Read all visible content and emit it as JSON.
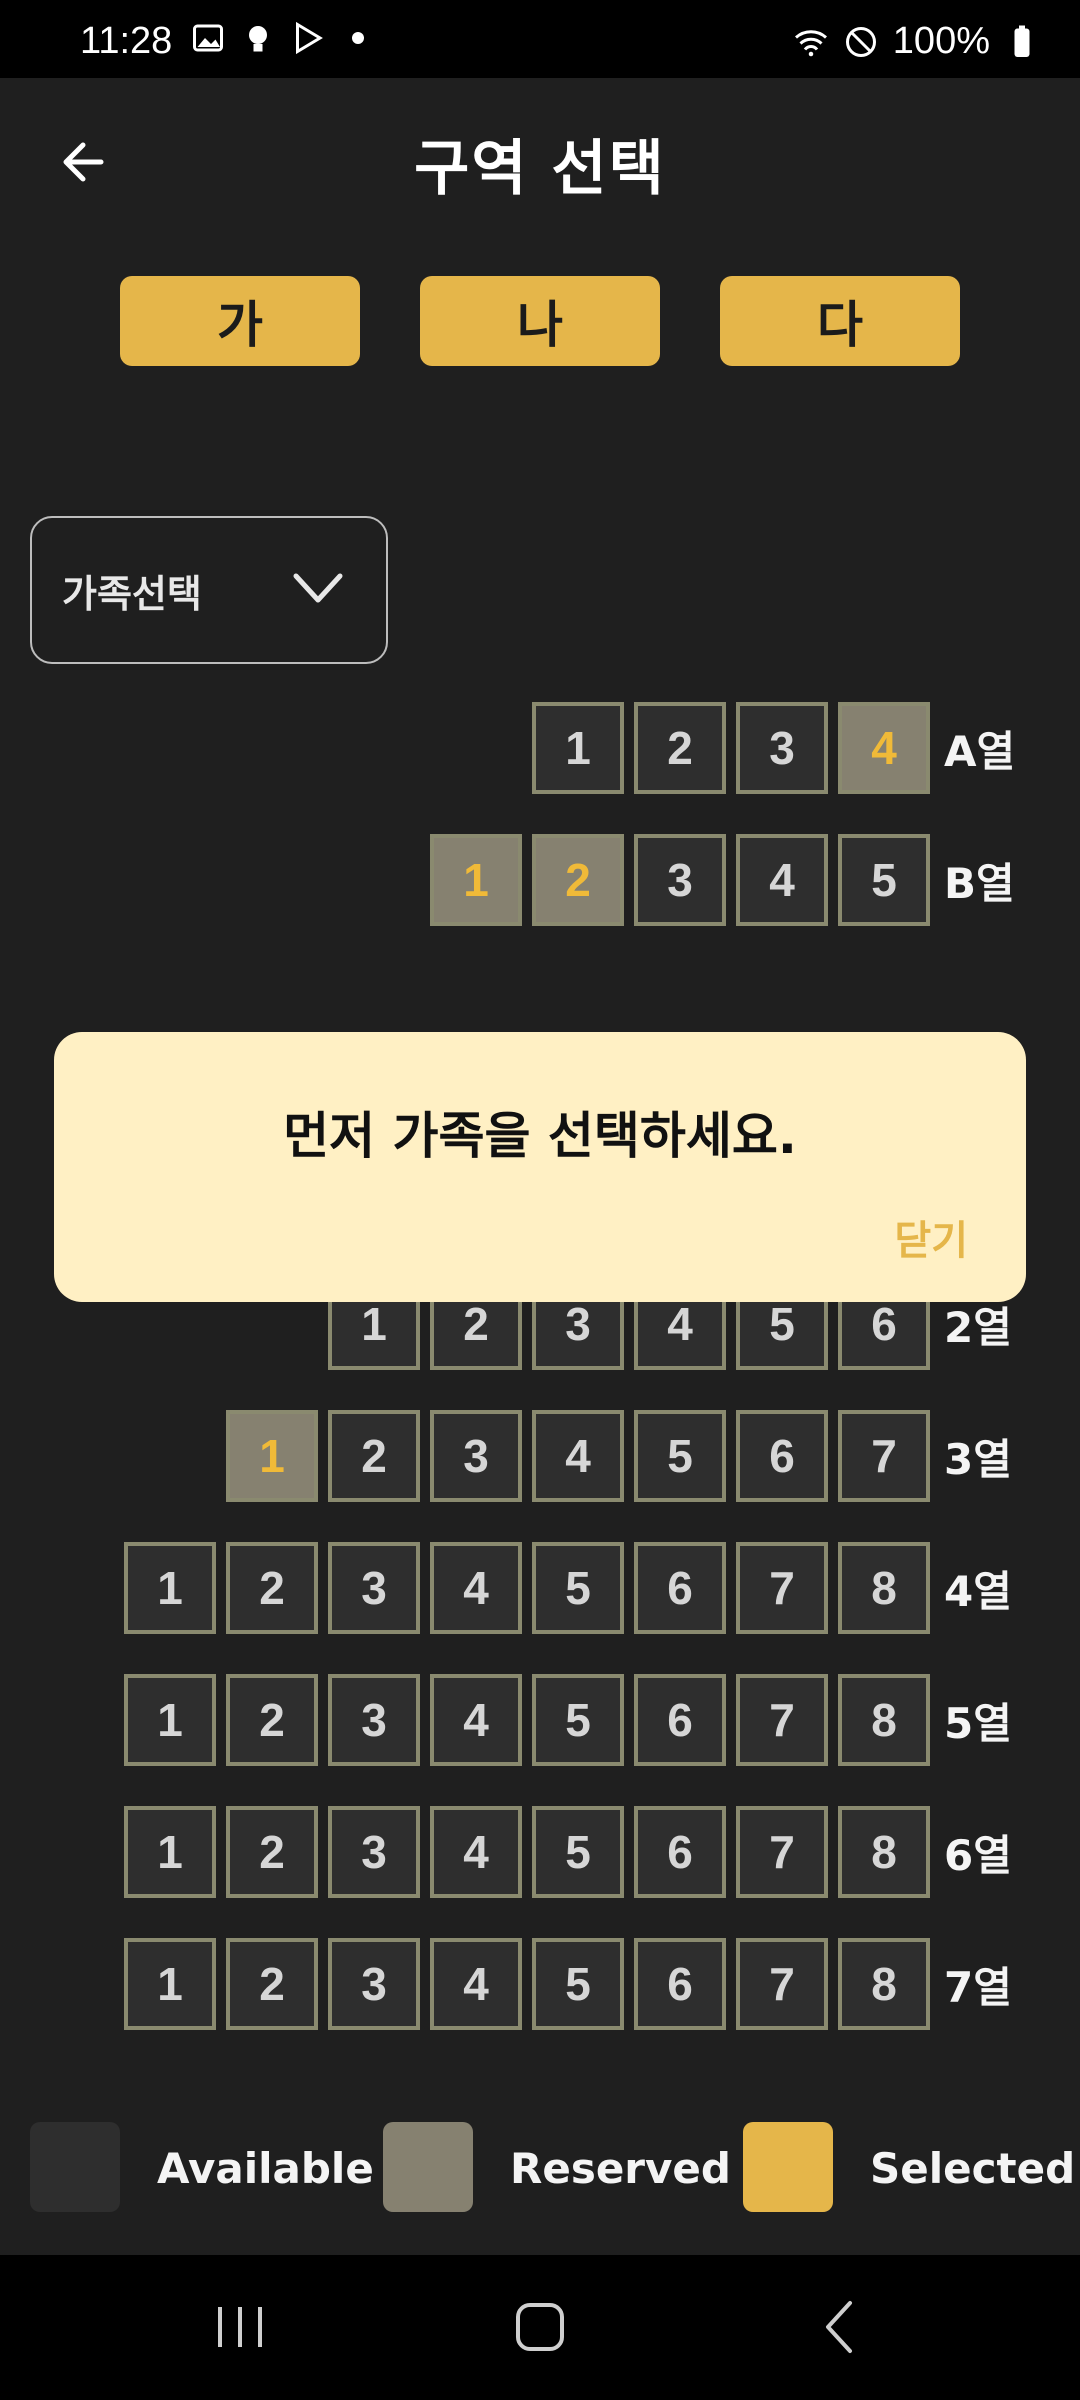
{
  "status_bar": {
    "time": "11:28",
    "battery": "100%",
    "icons": [
      "gallery-icon",
      "bulb-icon",
      "play-store-icon",
      "dot-icon",
      "wifi-icon",
      "do-not-disturb-icon",
      "battery-icon"
    ]
  },
  "header": {
    "title": "구역 선택",
    "back_icon": "back-arrow-icon"
  },
  "section_tabs": [
    {
      "label": "가"
    },
    {
      "label": "나"
    },
    {
      "label": "다"
    }
  ],
  "family_select": {
    "value": "가족선택",
    "icon": "chevron-down-icon"
  },
  "seat_rows": {
    "A": {
      "label": "A열",
      "seats": [
        "1",
        "2",
        "3",
        "4"
      ],
      "reserved": [
        "4"
      ]
    },
    "B": {
      "label": "B열",
      "seats": [
        "1",
        "2",
        "3",
        "4",
        "5"
      ],
      "reserved": [
        "1",
        "2"
      ]
    },
    "r2": {
      "label": "2열",
      "seats": [
        "1",
        "2",
        "3",
        "4",
        "5",
        "6"
      ],
      "reserved": []
    },
    "r3": {
      "label": "3열",
      "seats": [
        "1",
        "2",
        "3",
        "4",
        "5",
        "6",
        "7"
      ],
      "reserved": [
        "1"
      ]
    },
    "r4": {
      "label": "4열",
      "seats": [
        "1",
        "2",
        "3",
        "4",
        "5",
        "6",
        "7",
        "8"
      ],
      "reserved": []
    },
    "r5": {
      "label": "5열",
      "seats": [
        "1",
        "2",
        "3",
        "4",
        "5",
        "6",
        "7",
        "8"
      ],
      "reserved": []
    },
    "r6": {
      "label": "6열",
      "seats": [
        "1",
        "2",
        "3",
        "4",
        "5",
        "6",
        "7",
        "8"
      ],
      "reserved": []
    },
    "r7": {
      "label": "7열",
      "seats": [
        "1",
        "2",
        "3",
        "4",
        "5",
        "6",
        "7",
        "8"
      ],
      "reserved": []
    }
  },
  "dialog": {
    "message": "먼저 가족을 선택하세요.",
    "close_label": "닫기"
  },
  "legend": {
    "available": "Available",
    "reserved": "Reserved",
    "selected": "Selected"
  },
  "colors": {
    "background": "#1f1f1f",
    "accent": "#e5b64a",
    "available": "#2e2e2e",
    "reserved": "#868170",
    "seat_border": "#8a8a6f",
    "dialog_bg": "#fff0c4"
  },
  "nav_bar": {
    "icons": [
      "recent-apps-icon",
      "home-icon",
      "back-icon"
    ]
  }
}
